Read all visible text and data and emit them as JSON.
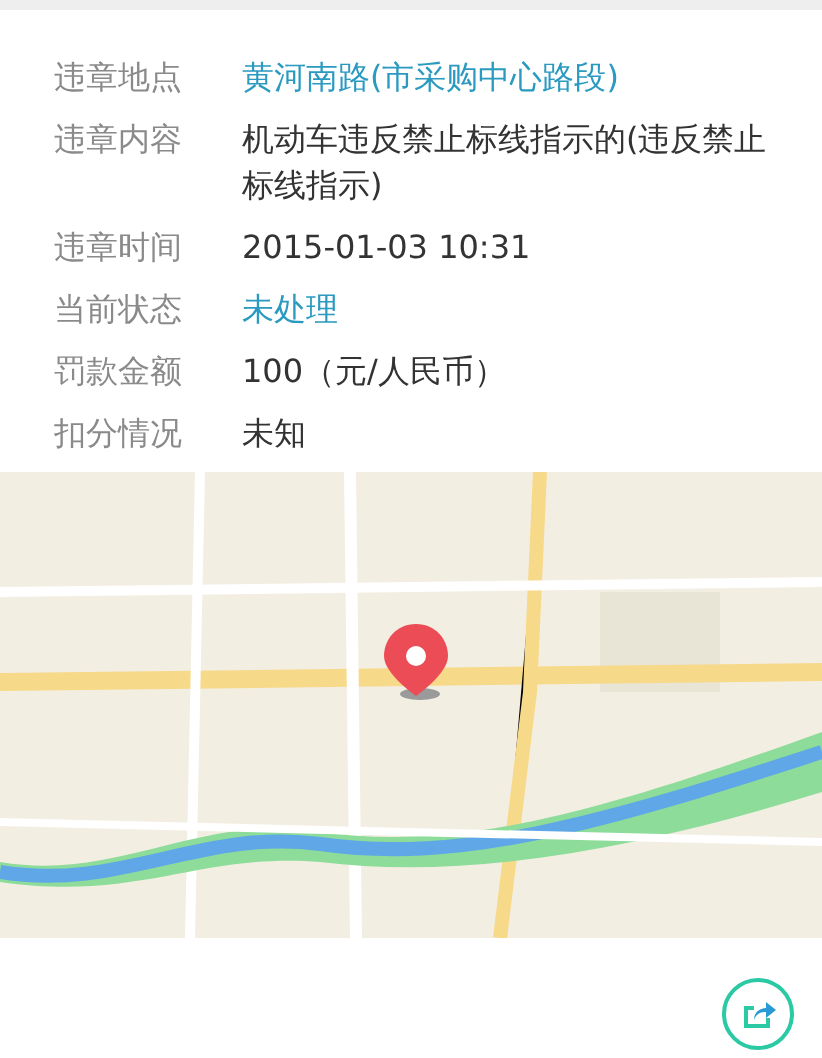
{
  "details": [
    {
      "label": "违章地点",
      "value": "黄河南路(市采购中心路段)",
      "highlighted": true
    },
    {
      "label": "违章内容",
      "value": "机动车违反禁止标线指示的(违反禁止标线指示)",
      "highlighted": false
    },
    {
      "label": "违章时间",
      "value": "2015-01-03 10:31",
      "highlighted": false
    },
    {
      "label": "当前状态",
      "value": "未处理",
      "highlighted": true
    },
    {
      "label": "罚款金额",
      "value": "100（元/人民币）",
      "highlighted": false
    },
    {
      "label": "扣分情况",
      "value": "未知",
      "highlighted": false
    }
  ]
}
